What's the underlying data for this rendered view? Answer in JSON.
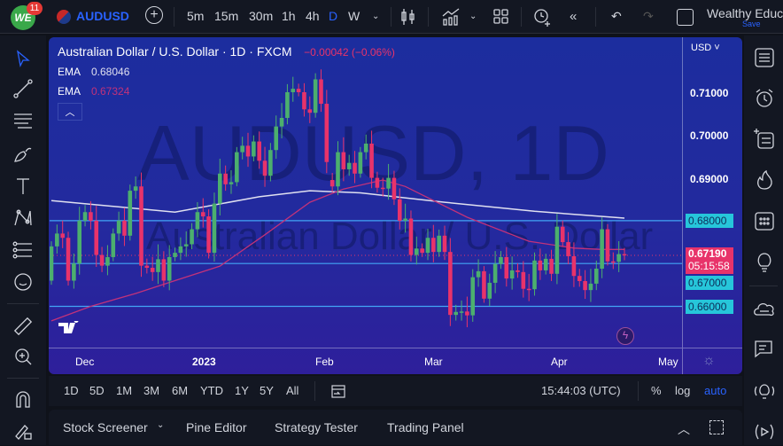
{
  "topbar": {
    "notifications": "11",
    "logo_text": "WE",
    "symbol": "AUDUSD",
    "intervals": [
      "5m",
      "15m",
      "30m",
      "1h",
      "4h",
      "D",
      "W"
    ],
    "active_interval": "D",
    "layout_name": "Wealthy Educ...",
    "save_label": "Save"
  },
  "legend": {
    "title": "Australian Dollar / U.S. Dollar · 1D · FXCM",
    "change": "−0.00042 (−0.06%)",
    "ema1_label": "EMA",
    "ema1_value": "0.68046",
    "ema2_label": "EMA",
    "ema2_value": "0.67324"
  },
  "watermark": {
    "line1": "AUDUSD, 1D",
    "line2": "Australian Dollar / U.S. Dollar"
  },
  "price_axis": {
    "currency": "USD",
    "labels": [
      "0.71000",
      "0.70000",
      "0.69000"
    ],
    "boxes": [
      "0.68000",
      "0.67000",
      "0.66000"
    ],
    "last_price": "0.67190",
    "countdown": "05:15:58"
  },
  "time_axis": {
    "labels": [
      "Dec",
      "2023",
      "Feb",
      "Mar",
      "Apr",
      "May"
    ]
  },
  "rangebar": {
    "ranges": [
      "1D",
      "5D",
      "1M",
      "3M",
      "6M",
      "YTD",
      "1Y",
      "5Y",
      "All"
    ],
    "time": "15:44:03 (UTC)",
    "percent": "%",
    "log": "log",
    "auto": "auto"
  },
  "bottombar": {
    "tabs": [
      "Stock Screener",
      "Pine Editor",
      "Strategy Tester",
      "Trading Panel"
    ]
  },
  "colors": {
    "up": "#4caf6e",
    "down": "#e8336a",
    "ema1": "#e0e0f0",
    "ema2": "#c2327a",
    "hline": "#42a5f5",
    "accent": "#2962ff"
  },
  "chart_data": {
    "type": "candlestick",
    "title": "Australian Dollar / U.S. Dollar · 1D · FXCM",
    "ylim": [
      0.6545,
      0.7225
    ],
    "hlines": [
      0.68,
      0.67,
      0.66
    ],
    "last": 0.6719,
    "first_open": 0.666,
    "gap_opens": {
      "50": 0.6895
    },
    "close": [
      0.674,
      0.677,
      0.676,
      0.666,
      0.67,
      0.68,
      0.682,
      0.68,
      0.672,
      0.6695,
      0.6715,
      0.677,
      0.68,
      0.6765,
      0.687,
      0.688,
      0.6695,
      0.669,
      0.668,
      0.671,
      0.666,
      0.6715,
      0.6725,
      0.674,
      0.6745,
      0.678,
      0.682,
      0.681,
      0.6725,
      0.684,
      0.691,
      0.6885,
      0.689,
      0.696,
      0.6975,
      0.695,
      0.6985,
      0.694,
      0.6905,
      0.6965,
      0.702,
      0.704,
      0.71,
      0.7108,
      0.71,
      0.706,
      0.7052,
      0.713,
      0.7073,
      0.6937,
      0.688,
      0.696,
      0.692,
      0.6935,
      0.691,
      0.696,
      0.698,
      0.69,
      0.6877,
      0.6875,
      0.69,
      0.685,
      0.68,
      0.6805,
      0.672,
      0.6735,
      0.6725,
      0.676,
      0.6727,
      0.6765,
      0.6727,
      0.658,
      0.6587,
      0.6588,
      0.6579,
      0.6668,
      0.6682,
      0.6618,
      0.6655,
      0.6699,
      0.6715,
      0.6665,
      0.6684,
      0.668,
      0.6641,
      0.664,
      0.6707,
      0.6684,
      0.6711,
      0.6676,
      0.6786,
      0.675,
      0.6717,
      0.6671,
      0.6659,
      0.6638,
      0.6653,
      0.6688,
      0.678,
      0.6705,
      0.6704,
      0.6722,
      0.6719
    ],
    "ema1": [
      [
        0,
        0.6847
      ],
      [
        22,
        0.682
      ],
      [
        37,
        0.6856
      ],
      [
        46,
        0.687
      ],
      [
        55,
        0.6865
      ],
      [
        70,
        0.6843
      ],
      [
        86,
        0.6822
      ],
      [
        102,
        0.6806
      ]
    ],
    "ema2": [
      [
        0,
        0.6566
      ],
      [
        7,
        0.66
      ],
      [
        15,
        0.663
      ],
      [
        22,
        0.666
      ],
      [
        30,
        0.6694
      ],
      [
        38,
        0.6767
      ],
      [
        46,
        0.6843
      ],
      [
        52,
        0.6874
      ],
      [
        59,
        0.6895
      ],
      [
        63,
        0.688
      ],
      [
        74,
        0.6808
      ],
      [
        85,
        0.6752
      ],
      [
        93,
        0.6736
      ],
      [
        98,
        0.6733
      ],
      [
        102,
        0.6733
      ]
    ]
  }
}
